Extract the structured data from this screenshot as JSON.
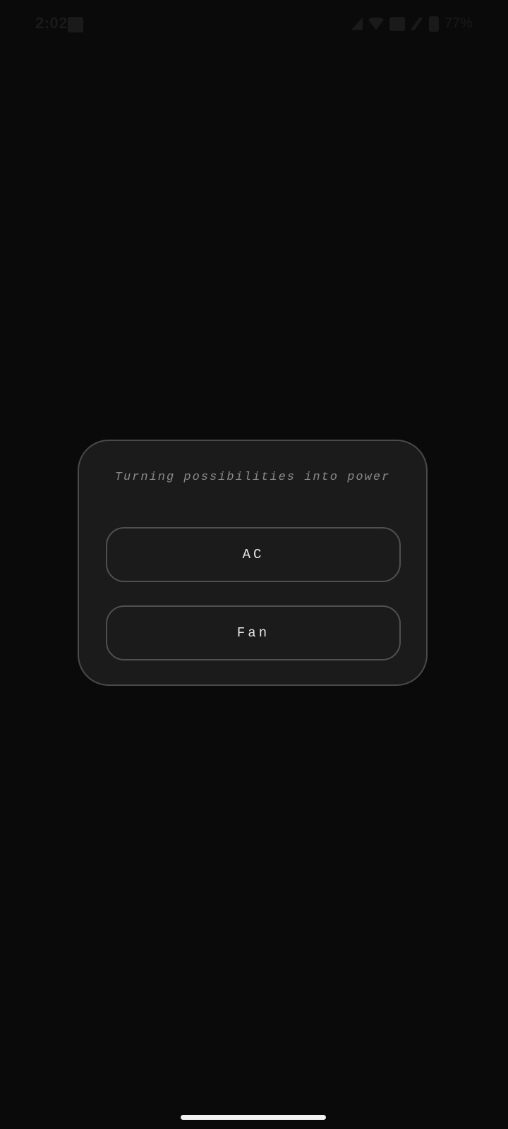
{
  "status_bar": {
    "time": "2:02",
    "battery": "77%"
  },
  "card": {
    "tagline": "Turning possibilities into power",
    "buttons": [
      {
        "label": "AC"
      },
      {
        "label": "Fan"
      }
    ]
  },
  "colors": {
    "background": "#0a0a0a",
    "card_background": "#1b1b1b",
    "card_border": "#4a4a4a",
    "button_text": "#e6e6e6",
    "tagline_text": "#8a8a8a",
    "home_indicator": "#f2f2f2"
  }
}
